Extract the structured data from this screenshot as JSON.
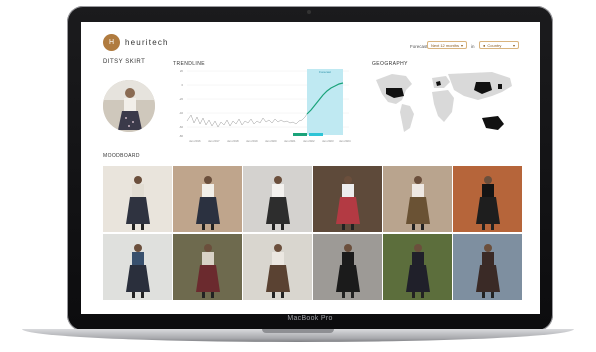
{
  "brand": {
    "logo_mark": "H",
    "name": "heuritech"
  },
  "toolbar": {
    "forecast_label": "Forecast",
    "forecast_value": "Next 12 months",
    "in_label": "in",
    "region_value": "Country"
  },
  "product": {
    "title": "DITSY SKIRT"
  },
  "sections": {
    "trendline": "TRENDLINE",
    "geography": "GEOGRAPHY",
    "moodboard": "MOODBOARD"
  },
  "trend_chart": {
    "forecast_tag": "Forecast",
    "x_ticks": [
      "Jan 2016",
      "Jan 2017",
      "Jan 2018",
      "Jan 2019",
      "Jan 2020",
      "Jan 2021",
      "Jan 2022",
      "Jan 2023",
      "Jan 2024"
    ],
    "y_ticks": [
      "20",
      "0",
      "-20",
      "-40",
      "-60",
      "-80"
    ],
    "legend": [
      "",
      ""
    ]
  },
  "colors": {
    "accent": "#b07b3f",
    "trend_line": "#7a7a7a",
    "forecast_line": "#1aa37a",
    "forecast_band": "#bfe9f2",
    "map_land": "#d9d9d9",
    "map_highlight": "#111111"
  },
  "device": {
    "model": "MacBook Pro"
  },
  "moodboard": [
    {
      "bg": "#e9e4dc",
      "figure": "#2f3340",
      "top": "#e2ddd3"
    },
    {
      "bg": "#bfa58c",
      "figure": "#2b3140",
      "top": "#f2efe9"
    },
    {
      "bg": "#d4d2cf",
      "figure": "#2d2d2d",
      "top": "#f4f2ef"
    },
    {
      "bg": "#5e4a3a",
      "figure": "#b33a43",
      "top": "#ededed"
    },
    {
      "bg": "#b9a48e",
      "figure": "#6a5234",
      "top": "#efe9e4"
    },
    {
      "bg": "#b6653a",
      "figure": "#1e1e1e",
      "top": "#141414"
    },
    {
      "bg": "#dfe0dd",
      "figure": "#2a2f3c",
      "top": "#38506d"
    },
    {
      "bg": "#6e6a4e",
      "figure": "#6b2a2e",
      "top": "#d8d2c6"
    },
    {
      "bg": "#d9d6cf",
      "figure": "#5a4232",
      "top": "#ebe7e1"
    },
    {
      "bg": "#9d9a96",
      "figure": "#1b1b1b",
      "top": "#1b1b1b"
    },
    {
      "bg": "#5c6e3c",
      "figure": "#20202a",
      "top": "#20202a"
    },
    {
      "bg": "#7e8fa0",
      "figure": "#3a2a26",
      "top": "#3a2a26"
    }
  ]
}
